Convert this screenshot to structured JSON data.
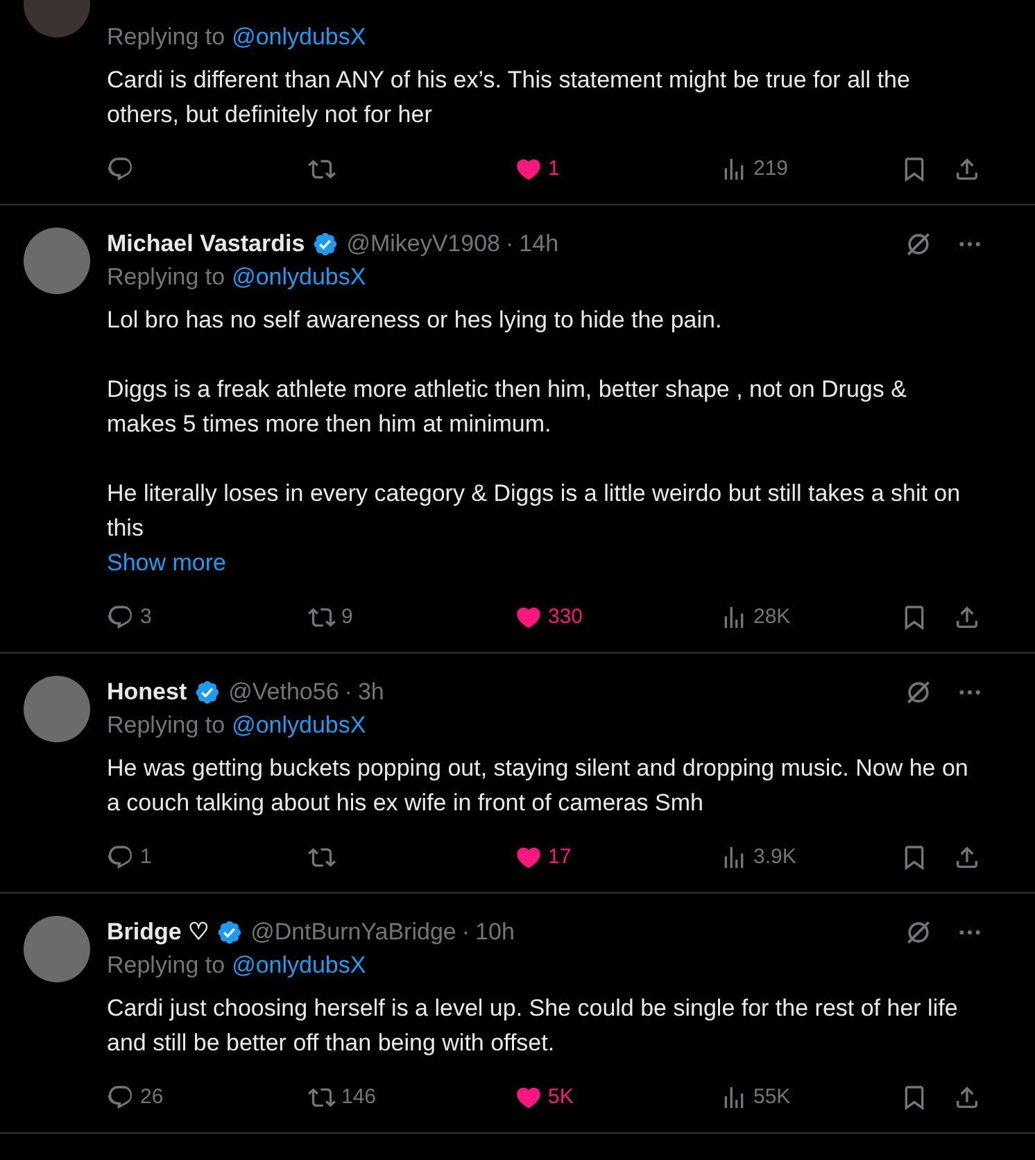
{
  "tweets": [
    {
      "replying_label": "Replying to",
      "replying_to": "@onlydubsX",
      "body": [
        "Cardi is different than ANY of his ex’s. This statement might be true for all the others, but definitely not for her"
      ],
      "likes": "1",
      "liked": true,
      "views": "219"
    },
    {
      "author": "Michael Vastardis",
      "handle": "@MikeyV1908",
      "separator": "·",
      "time": "14h",
      "verified": true,
      "replying_label": "Replying to",
      "replying_to": "@onlydubsX",
      "body": [
        "Lol bro has no self awareness or hes lying to hide the pain.",
        "Diggs is a freak athlete more athletic then him, better shape , not on Drugs & makes 5 times more then him at minimum.",
        "He literally loses in every category & Diggs is a little weirdo but still takes a shit on this"
      ],
      "show_more": "Show more",
      "replies": "3",
      "reposts": "9",
      "likes": "330",
      "liked": true,
      "views": "28K"
    },
    {
      "author": "Honest",
      "handle": "@Vetho56",
      "separator": "·",
      "time": "3h",
      "verified": true,
      "replying_label": "Replying to",
      "replying_to": "@onlydubsX",
      "body": [
        "He was getting buckets popping out, staying silent and dropping music. Now he on a couch talking about his ex wife in front of cameras Smh"
      ],
      "replies": "1",
      "likes": "17",
      "liked": true,
      "views": "3.9K"
    },
    {
      "author": "Bridge ♡",
      "handle": "@DntBurnYaBridge",
      "separator": "·",
      "time": "10h",
      "verified": true,
      "replying_label": "Replying to",
      "replying_to": "@onlydubsX",
      "body": [
        "Cardi just choosing herself is a level up. She could be single for the rest of her life and still be better off than being with offset."
      ],
      "replies": "26",
      "reposts": "146",
      "likes": "5K",
      "liked": true,
      "views": "55K"
    }
  ]
}
